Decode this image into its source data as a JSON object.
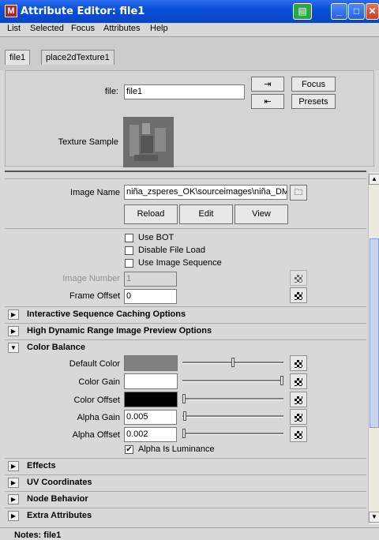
{
  "window": {
    "title": "Attribute Editor: file1"
  },
  "menu": [
    "List",
    "Selected",
    "Focus",
    "Attributes",
    "Help"
  ],
  "tabs": [
    "file1",
    "place2dTexture1"
  ],
  "header": {
    "file_label": "file:",
    "file_value": "file1",
    "focus_label": "Focus",
    "presets_label": "Presets",
    "texture_sample_label": "Texture Sample"
  },
  "image": {
    "name_label": "Image Name",
    "name_value": "niña_zsperes_OK\\sourceimages\\niña_DM",
    "reload_label": "Reload",
    "edit_label": "Edit",
    "view_label": "View"
  },
  "options": {
    "use_bot": "Use BOT",
    "disable_file_load": "Disable File Load",
    "use_image_sequence": "Use Image Sequence",
    "image_number_label": "Image Number",
    "image_number_value": "1",
    "frame_offset_label": "Frame Offset",
    "frame_offset_value": "0"
  },
  "sections": {
    "caching": "Interactive Sequence Caching Options",
    "hdr": "High Dynamic Range Image Preview Options",
    "color_balance": "Color Balance",
    "effects": "Effects",
    "uv": "UV Coordinates",
    "node_behavior": "Node Behavior",
    "extra": "Extra Attributes"
  },
  "color_balance": {
    "default_color_label": "Default Color",
    "default_color_value": "#808080",
    "default_color_level": 0.5,
    "color_gain_label": "Color Gain",
    "color_gain_value": "#ffffff",
    "color_gain_level": 1.0,
    "color_offset_label": "Color Offset",
    "color_offset_value": "#000000",
    "color_offset_level": 0.0,
    "alpha_gain_label": "Alpha Gain",
    "alpha_gain_value": "0.005",
    "alpha_gain_level": 0.005,
    "alpha_offset_label": "Alpha Offset",
    "alpha_offset_value": "0.002",
    "alpha_offset_level": 0.002,
    "alpha_is_luminance": "Alpha Is Luminance"
  },
  "notes": {
    "label": "Notes: file1"
  }
}
